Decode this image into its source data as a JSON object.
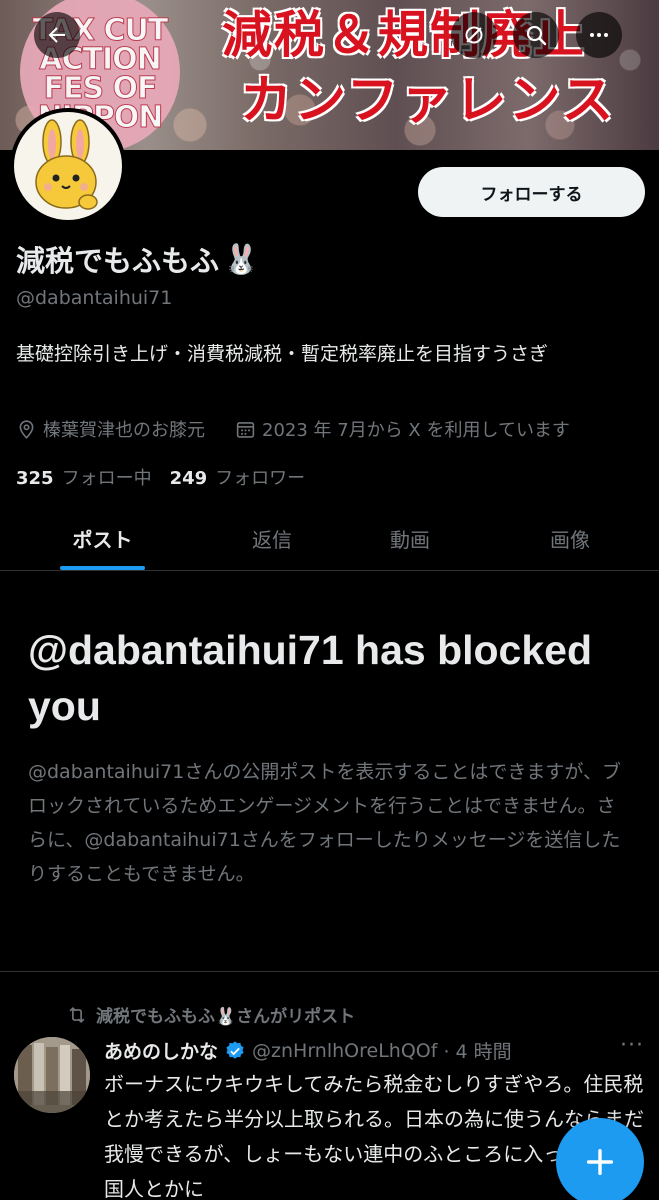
{
  "banner": {
    "badge_lines": [
      "TAX CUT",
      "ACTION",
      "FES OF",
      "NIPPON"
    ],
    "title_line1": "減税＆規制廃止",
    "title_line2": "カンファレンス"
  },
  "profile": {
    "follow_label": "フォローする",
    "display_name": "減税でもふもふ",
    "name_emoji": "🐰",
    "handle": "@dabantaihui71",
    "bio": "基礎控除引き上げ・消費税減税・暫定税率廃止を目指すうさぎ",
    "location": "榛葉賀津也のお膝元",
    "joined": "2023 年 7月から X を利用しています",
    "following_count": "325",
    "following_label": "フォロー中",
    "followers_count": "249",
    "followers_label": "フォロワー"
  },
  "tabs": [
    {
      "label": "ポスト"
    },
    {
      "label": "返信"
    },
    {
      "label": "動画"
    },
    {
      "label": "画像"
    }
  ],
  "blocked": {
    "title": "@dabantaihui71 has blocked you",
    "description": "@dabantaihui71さんの公開ポストを表示することはできますが、ブロックされているためエンゲージメントを行うことはできません。さらに、@dabantaihui71さんをフォローしたりメッセージを送信したりすることもできません。"
  },
  "post": {
    "repost_label": "減税でもふもふ🐰さんがリポスト",
    "author_name": "あめのしかな",
    "author_handle": "@znHrnlhOreLhQOf",
    "time": "· 4 時間",
    "more": "···",
    "text": "ボーナスにウキウキしてみたら税金むしりすぎやろ。住民税とか考えたら半分以上取られる。日本の為に使うんならまだ我慢できるが、しょーもない連中のふところに入ったり、外国人とかに"
  },
  "colors": {
    "accent": "#1d9bf0",
    "background": "#000000",
    "text_primary": "#e7e9ea",
    "text_secondary": "#71767b",
    "banner_red": "#d8121f"
  },
  "icons": {
    "back": "arrow-left-icon",
    "grok": "grok-icon",
    "search": "search-icon",
    "more": "more-icon",
    "location": "location-pin-icon",
    "calendar": "calendar-icon",
    "repost": "repost-icon",
    "verified": "verified-badge-icon",
    "compose": "plus-icon"
  }
}
